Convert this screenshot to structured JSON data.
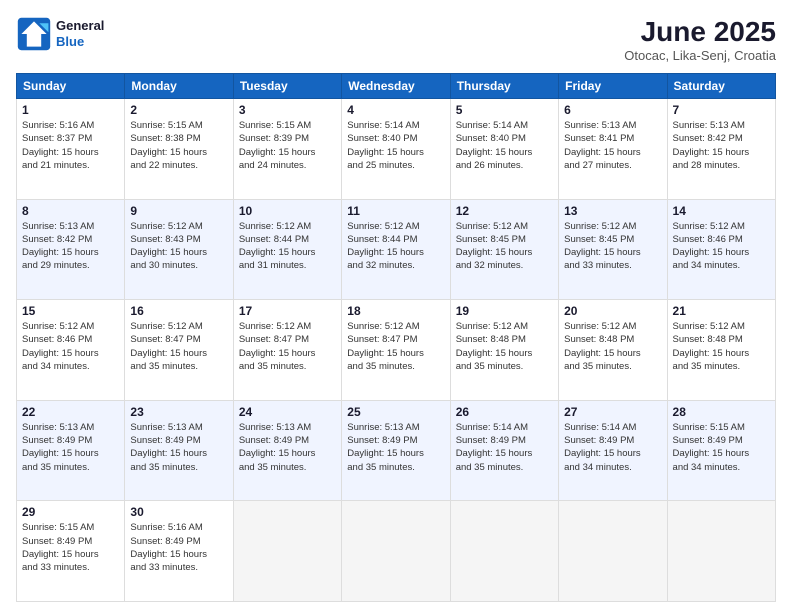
{
  "header": {
    "logo_line1": "General",
    "logo_line2": "Blue",
    "month": "June 2025",
    "location": "Otocac, Lika-Senj, Croatia"
  },
  "weekdays": [
    "Sunday",
    "Monday",
    "Tuesday",
    "Wednesday",
    "Thursday",
    "Friday",
    "Saturday"
  ],
  "weeks": [
    [
      {
        "day": "1",
        "info": "Sunrise: 5:16 AM\nSunset: 8:37 PM\nDaylight: 15 hours\nand 21 minutes."
      },
      {
        "day": "2",
        "info": "Sunrise: 5:15 AM\nSunset: 8:38 PM\nDaylight: 15 hours\nand 22 minutes."
      },
      {
        "day": "3",
        "info": "Sunrise: 5:15 AM\nSunset: 8:39 PM\nDaylight: 15 hours\nand 24 minutes."
      },
      {
        "day": "4",
        "info": "Sunrise: 5:14 AM\nSunset: 8:40 PM\nDaylight: 15 hours\nand 25 minutes."
      },
      {
        "day": "5",
        "info": "Sunrise: 5:14 AM\nSunset: 8:40 PM\nDaylight: 15 hours\nand 26 minutes."
      },
      {
        "day": "6",
        "info": "Sunrise: 5:13 AM\nSunset: 8:41 PM\nDaylight: 15 hours\nand 27 minutes."
      },
      {
        "day": "7",
        "info": "Sunrise: 5:13 AM\nSunset: 8:42 PM\nDaylight: 15 hours\nand 28 minutes."
      }
    ],
    [
      {
        "day": "8",
        "info": "Sunrise: 5:13 AM\nSunset: 8:42 PM\nDaylight: 15 hours\nand 29 minutes."
      },
      {
        "day": "9",
        "info": "Sunrise: 5:12 AM\nSunset: 8:43 PM\nDaylight: 15 hours\nand 30 minutes."
      },
      {
        "day": "10",
        "info": "Sunrise: 5:12 AM\nSunset: 8:44 PM\nDaylight: 15 hours\nand 31 minutes."
      },
      {
        "day": "11",
        "info": "Sunrise: 5:12 AM\nSunset: 8:44 PM\nDaylight: 15 hours\nand 32 minutes."
      },
      {
        "day": "12",
        "info": "Sunrise: 5:12 AM\nSunset: 8:45 PM\nDaylight: 15 hours\nand 32 minutes."
      },
      {
        "day": "13",
        "info": "Sunrise: 5:12 AM\nSunset: 8:45 PM\nDaylight: 15 hours\nand 33 minutes."
      },
      {
        "day": "14",
        "info": "Sunrise: 5:12 AM\nSunset: 8:46 PM\nDaylight: 15 hours\nand 34 minutes."
      }
    ],
    [
      {
        "day": "15",
        "info": "Sunrise: 5:12 AM\nSunset: 8:46 PM\nDaylight: 15 hours\nand 34 minutes."
      },
      {
        "day": "16",
        "info": "Sunrise: 5:12 AM\nSunset: 8:47 PM\nDaylight: 15 hours\nand 35 minutes."
      },
      {
        "day": "17",
        "info": "Sunrise: 5:12 AM\nSunset: 8:47 PM\nDaylight: 15 hours\nand 35 minutes."
      },
      {
        "day": "18",
        "info": "Sunrise: 5:12 AM\nSunset: 8:47 PM\nDaylight: 15 hours\nand 35 minutes."
      },
      {
        "day": "19",
        "info": "Sunrise: 5:12 AM\nSunset: 8:48 PM\nDaylight: 15 hours\nand 35 minutes."
      },
      {
        "day": "20",
        "info": "Sunrise: 5:12 AM\nSunset: 8:48 PM\nDaylight: 15 hours\nand 35 minutes."
      },
      {
        "day": "21",
        "info": "Sunrise: 5:12 AM\nSunset: 8:48 PM\nDaylight: 15 hours\nand 35 minutes."
      }
    ],
    [
      {
        "day": "22",
        "info": "Sunrise: 5:13 AM\nSunset: 8:49 PM\nDaylight: 15 hours\nand 35 minutes."
      },
      {
        "day": "23",
        "info": "Sunrise: 5:13 AM\nSunset: 8:49 PM\nDaylight: 15 hours\nand 35 minutes."
      },
      {
        "day": "24",
        "info": "Sunrise: 5:13 AM\nSunset: 8:49 PM\nDaylight: 15 hours\nand 35 minutes."
      },
      {
        "day": "25",
        "info": "Sunrise: 5:13 AM\nSunset: 8:49 PM\nDaylight: 15 hours\nand 35 minutes."
      },
      {
        "day": "26",
        "info": "Sunrise: 5:14 AM\nSunset: 8:49 PM\nDaylight: 15 hours\nand 35 minutes."
      },
      {
        "day": "27",
        "info": "Sunrise: 5:14 AM\nSunset: 8:49 PM\nDaylight: 15 hours\nand 34 minutes."
      },
      {
        "day": "28",
        "info": "Sunrise: 5:15 AM\nSunset: 8:49 PM\nDaylight: 15 hours\nand 34 minutes."
      }
    ],
    [
      {
        "day": "29",
        "info": "Sunrise: 5:15 AM\nSunset: 8:49 PM\nDaylight: 15 hours\nand 33 minutes."
      },
      {
        "day": "30",
        "info": "Sunrise: 5:16 AM\nSunset: 8:49 PM\nDaylight: 15 hours\nand 33 minutes."
      },
      {
        "day": "",
        "info": ""
      },
      {
        "day": "",
        "info": ""
      },
      {
        "day": "",
        "info": ""
      },
      {
        "day": "",
        "info": ""
      },
      {
        "day": "",
        "info": ""
      }
    ]
  ]
}
